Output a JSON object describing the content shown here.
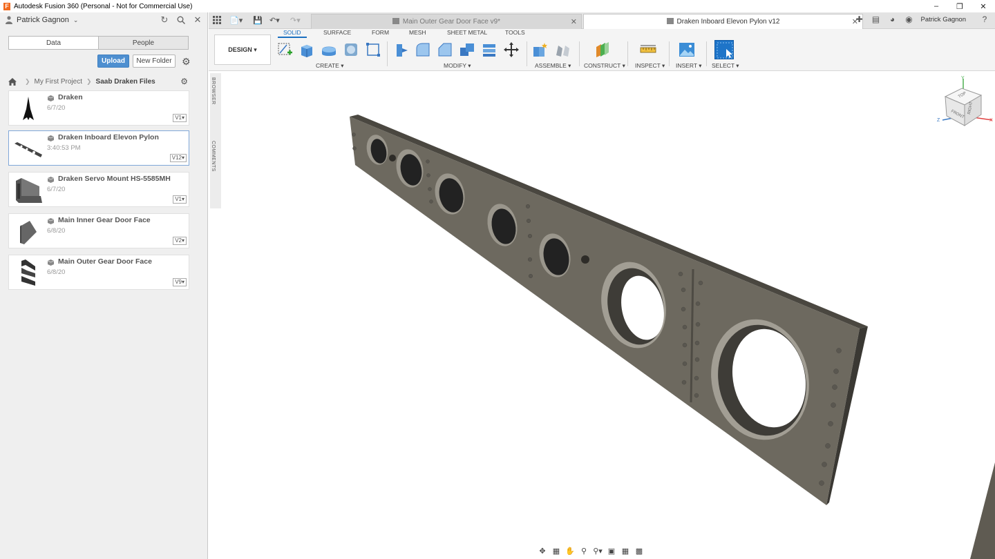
{
  "window": {
    "title": "Autodesk Fusion 360 (Personal - Not for Commercial Use)",
    "app_icon_letter": "F"
  },
  "data_panel": {
    "user_name": "Patrick Gagnon",
    "tabs": [
      "Data",
      "People"
    ],
    "upload_label": "Upload",
    "new_folder_label": "New Folder",
    "breadcrumb": [
      "My First Project",
      "Saab Draken Files"
    ],
    "files": [
      {
        "name": "Draken",
        "date": "6/7/20",
        "version": "V1▾"
      },
      {
        "name": "Draken Inboard Elevon Pylon",
        "date": "3:40:53 PM",
        "version": "V12▾"
      },
      {
        "name": "Draken Servo Mount HS-5585MH",
        "date": "6/7/20",
        "version": "V1▾"
      },
      {
        "name": "Main Inner Gear Door Face",
        "date": "6/8/20",
        "version": "V2▾"
      },
      {
        "name": "Main Outer Gear Door Face",
        "date": "6/8/20",
        "version": "V9▾"
      }
    ]
  },
  "doc_tabs": {
    "inactive": "Main Outer Gear Door Face v9*",
    "active": "Draken Inboard Elevon Pylon v12",
    "account_name": "Patrick Gagnon"
  },
  "toolbar": {
    "workspace": "DESIGN ▾",
    "ribbon_tabs": [
      "SOLID",
      "SURFACE",
      "FORM",
      "MESH",
      "SHEET METAL",
      "TOOLS"
    ],
    "groups": [
      "CREATE ▾",
      "MODIFY ▾",
      "ASSEMBLE ▾",
      "CONSTRUCT ▾",
      "INSPECT ▾",
      "INSERT ▾",
      "SELECT ▾"
    ]
  },
  "side_panels": {
    "browser": "BROWSER",
    "comments": "COMMENTS"
  },
  "viewcube": {
    "top": "TOP",
    "front": "FRONT",
    "right": "RIGHT",
    "axis_x": "X",
    "axis_y": "Y",
    "axis_z": "Z"
  },
  "colors": {
    "accent": "#1a6fc0",
    "upload": "#4e8fd0",
    "model": "#6e6a60"
  }
}
